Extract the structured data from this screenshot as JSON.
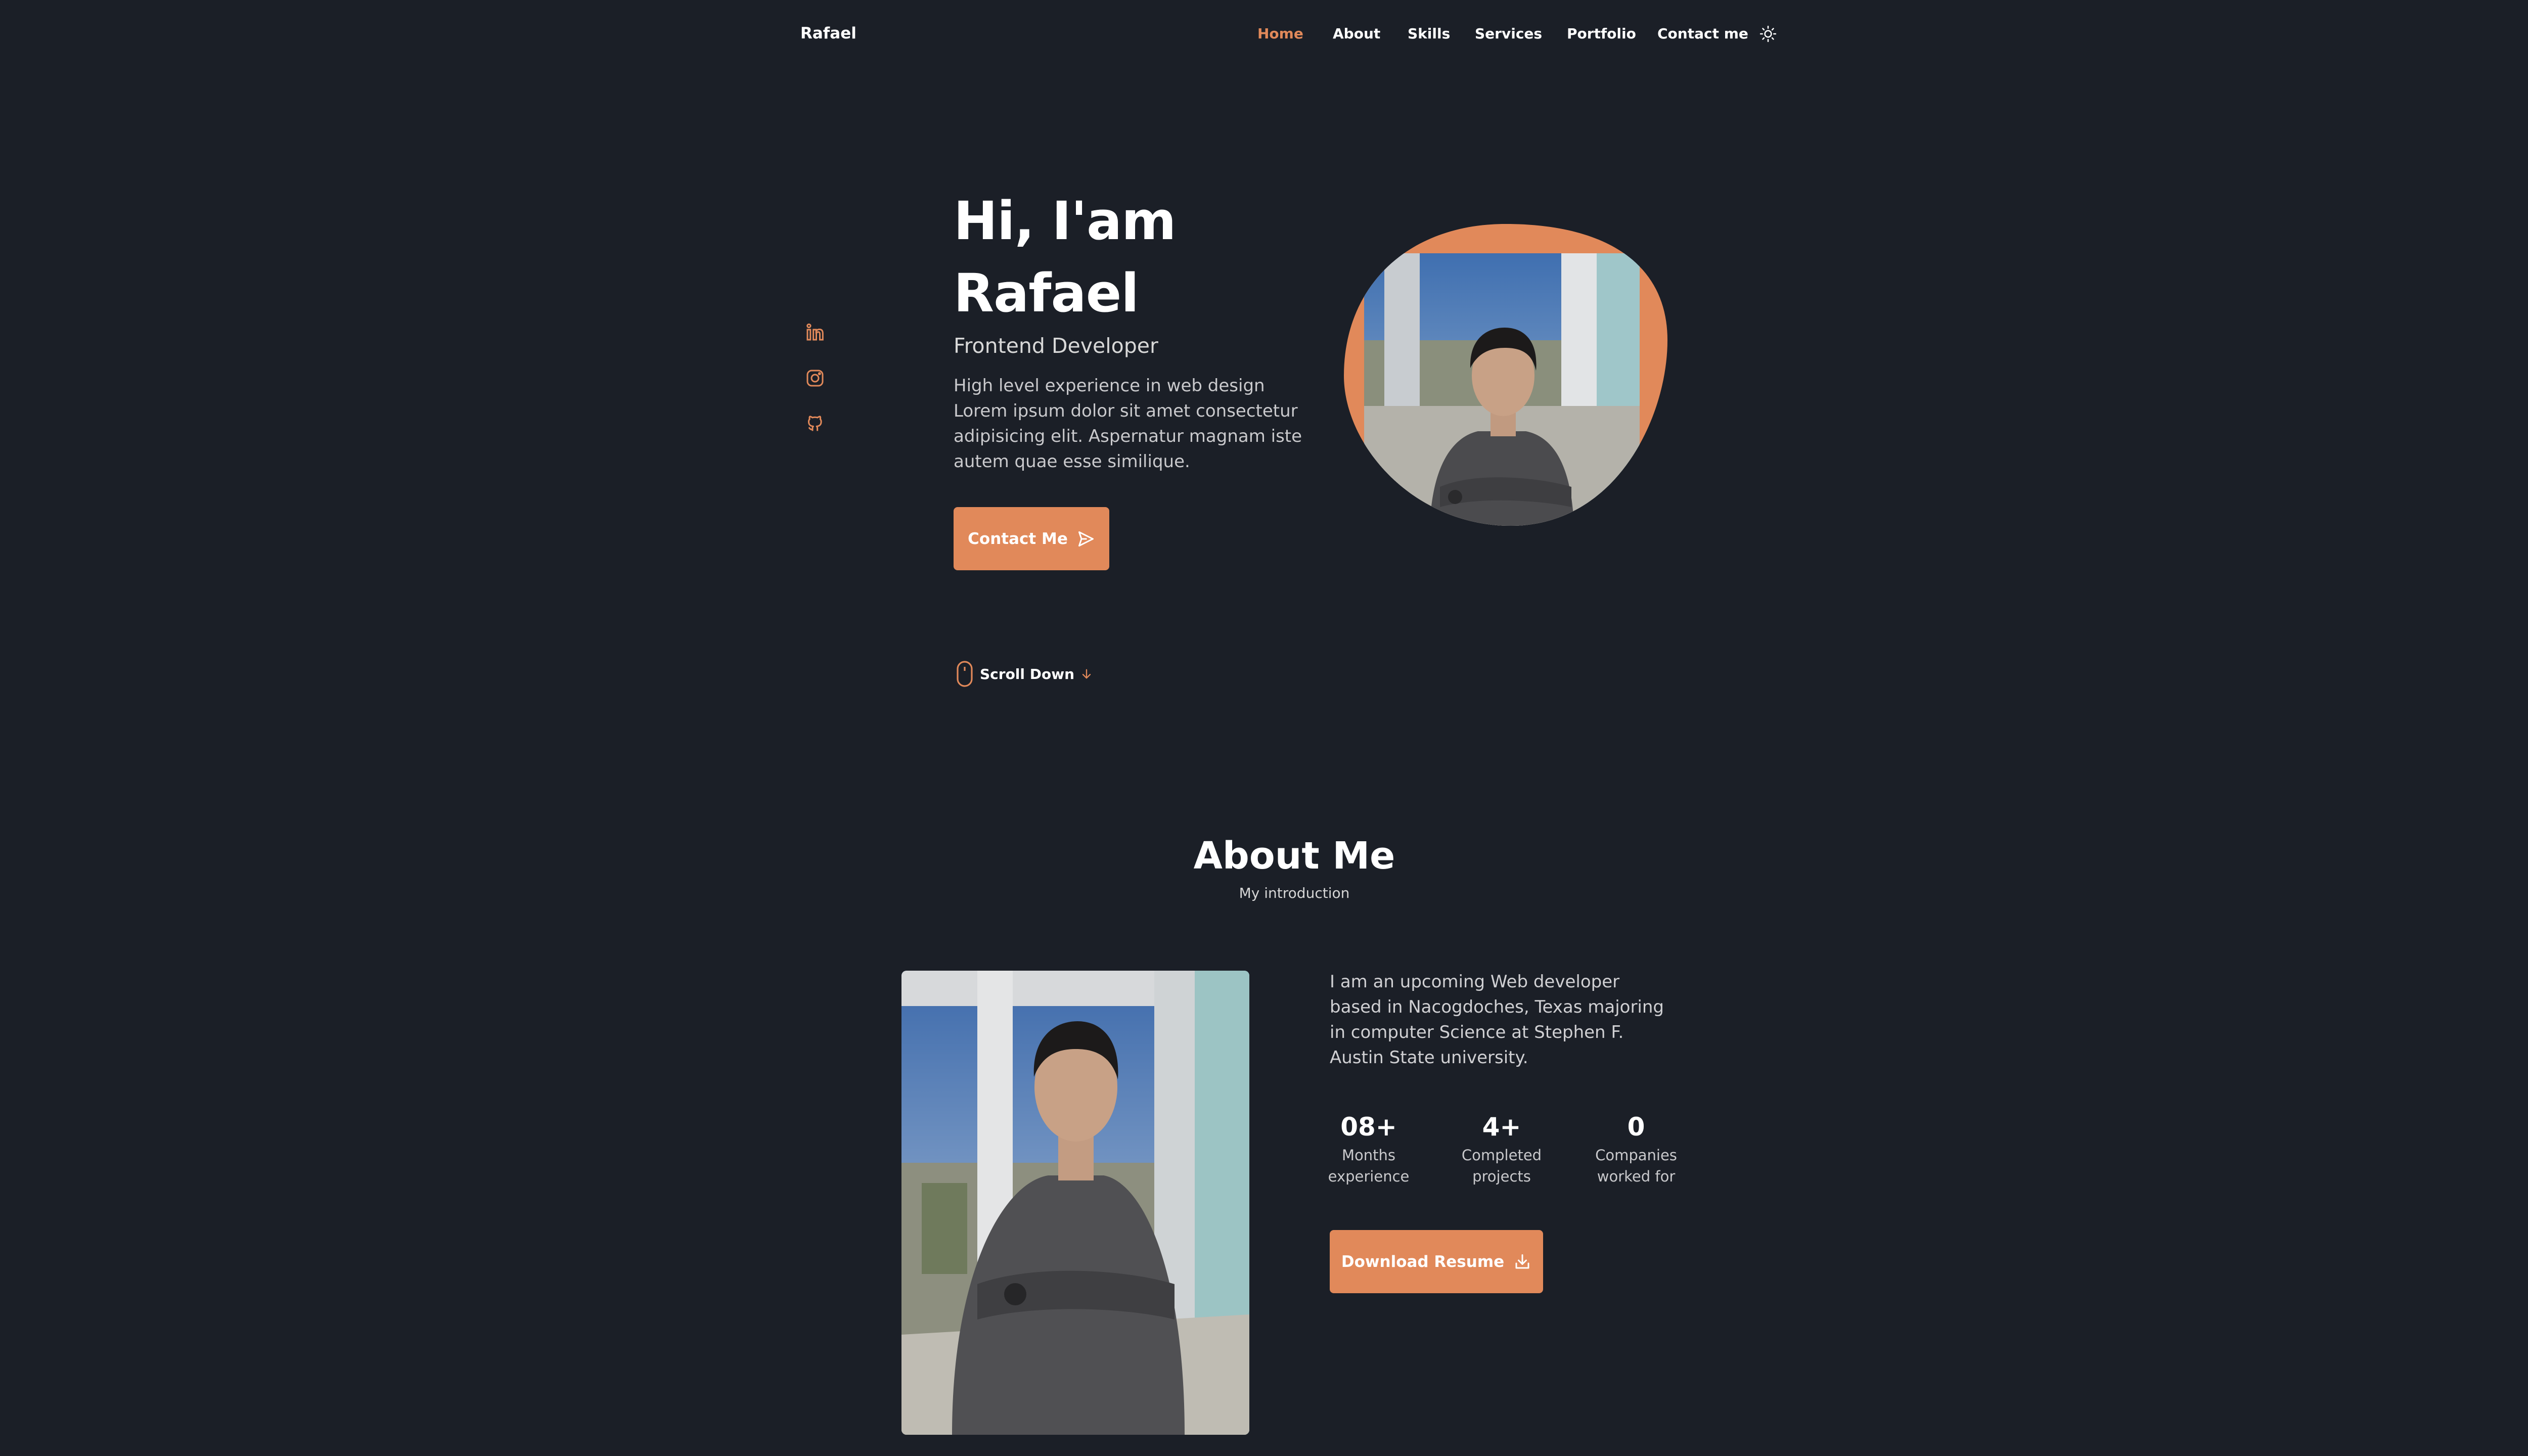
{
  "header": {
    "logo": "Rafael",
    "nav": [
      "Home",
      "About",
      "Skills",
      "Services",
      "Portfolio",
      "Contact me"
    ],
    "active_nav": "Home",
    "theme_icon": "sun-icon"
  },
  "social": [
    "linkedin-icon",
    "instagram-icon",
    "github-icon"
  ],
  "hero": {
    "title_line1": "Hi, I'am",
    "title_line2": "Rafael",
    "subtitle": "Frontend Developer",
    "description": "High level experience in web design Lorem ipsum dolor sit amet consectetur adipisicing elit. Aspernatur magnam iste autem quae esse similique.",
    "button_label": "Contact Me",
    "scroll_label": "Scroll Down"
  },
  "about": {
    "title": "About Me",
    "subtitle": "My introduction",
    "text": "I am an upcoming Web developer based in Nacogdoches, Texas majoring in computer Science at Stephen F. Austin State university.",
    "stats": [
      {
        "value": "08+",
        "label": "Months\nexperience"
      },
      {
        "value": "4+",
        "label": "Completed\nprojects"
      },
      {
        "value": "0",
        "label": "Companies\nworked for"
      }
    ],
    "resume_label": "Download Resume"
  },
  "colors": {
    "background": "#1b1f27",
    "accent": "#e1895a",
    "text": "#ffffff"
  }
}
